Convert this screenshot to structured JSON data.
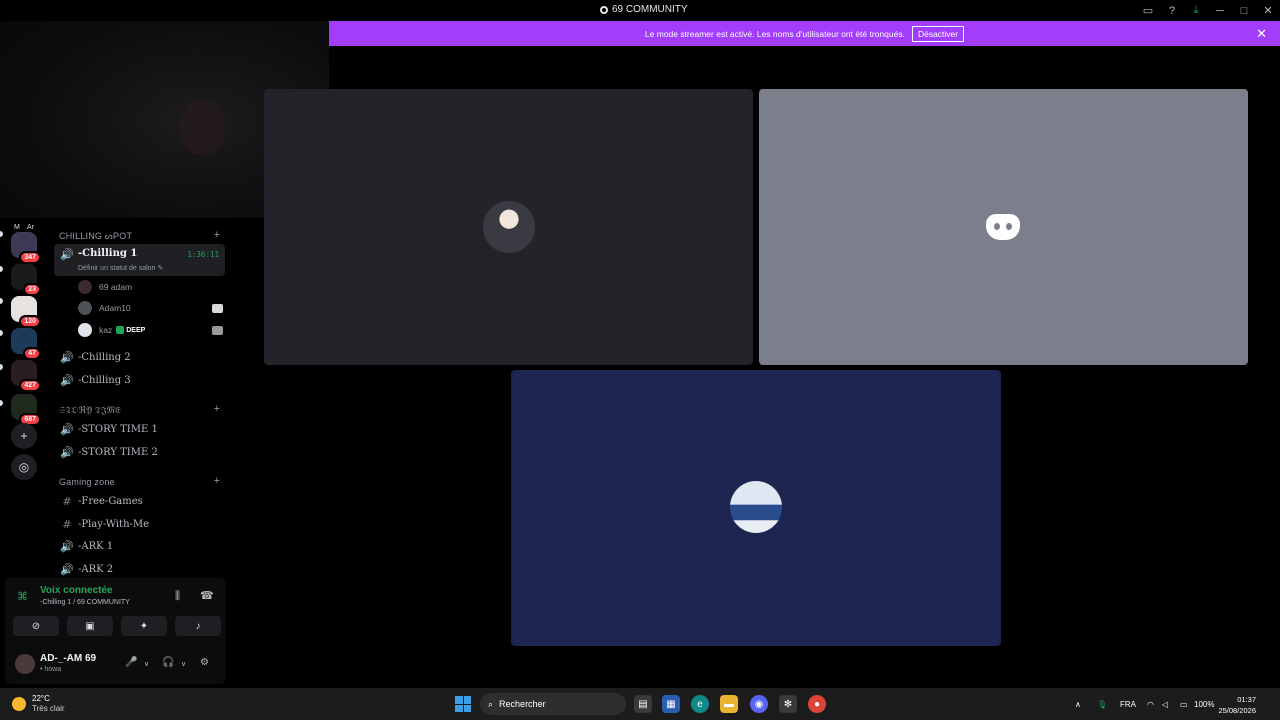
{
  "window": {
    "title": "69 COMMUNITY",
    "icons": [
      "inbox-icon",
      "help-icon",
      "download-icon",
      "minimize-icon",
      "maximize-icon",
      "close-icon"
    ]
  },
  "banner": {
    "message": "Le mode streamer est activé. Les noms d'utilisateur ont été tronqués.",
    "button": "Désactiver",
    "close": "✕",
    "color": "#a23dfb"
  },
  "servers": [
    {
      "badge": "347"
    },
    {
      "badge": "23"
    },
    {
      "badge": "120"
    },
    {
      "badge": "47"
    },
    {
      "badge": "427"
    },
    {
      "badge": "687"
    }
  ],
  "server_rail_top_labels": [
    "M",
    "Ar"
  ],
  "categories": {
    "chilling": "CHILLING ᔕPOT",
    "story": "𝔖𝔗𝔒ℜ𝔜 𝔗𝔍𝔐𝔈",
    "gaming": "Gaming zone"
  },
  "channels": {
    "chilling1": {
      "name": "-Chilling 1",
      "timer": "1:36:11",
      "status": "Définir un statut de salon ✎"
    },
    "chilling2": {
      "name": "-Chilling 2"
    },
    "chilling3": {
      "name": "-Chilling 3"
    },
    "story1": {
      "name": "-STORY TIME 1"
    },
    "story2": {
      "name": "-STORY TIME 2"
    },
    "free_games": {
      "name": "-Free-Games"
    },
    "play_with_me": {
      "name": "-Play-With-Me"
    },
    "ark1": {
      "name": "-ARK 1"
    },
    "ark2": {
      "name": "-ARK 2"
    }
  },
  "members": [
    {
      "name": "69 adam"
    },
    {
      "name": "Adam10"
    },
    {
      "name": "kaz",
      "tag": "DEEP"
    }
  ],
  "voice_panel": {
    "status": "Voix connectée",
    "location": "-Chilling 1 / 69 COMMUNITY",
    "user_name": "AD-_-AM 69",
    "user_status": "• howa"
  },
  "taskbar": {
    "temp": "22°C",
    "condition": "Très clair",
    "search_placeholder": "Rechercher",
    "lang": "FRA",
    "battery": "100%",
    "time": "01:37",
    "date": "25/08/2026"
  }
}
